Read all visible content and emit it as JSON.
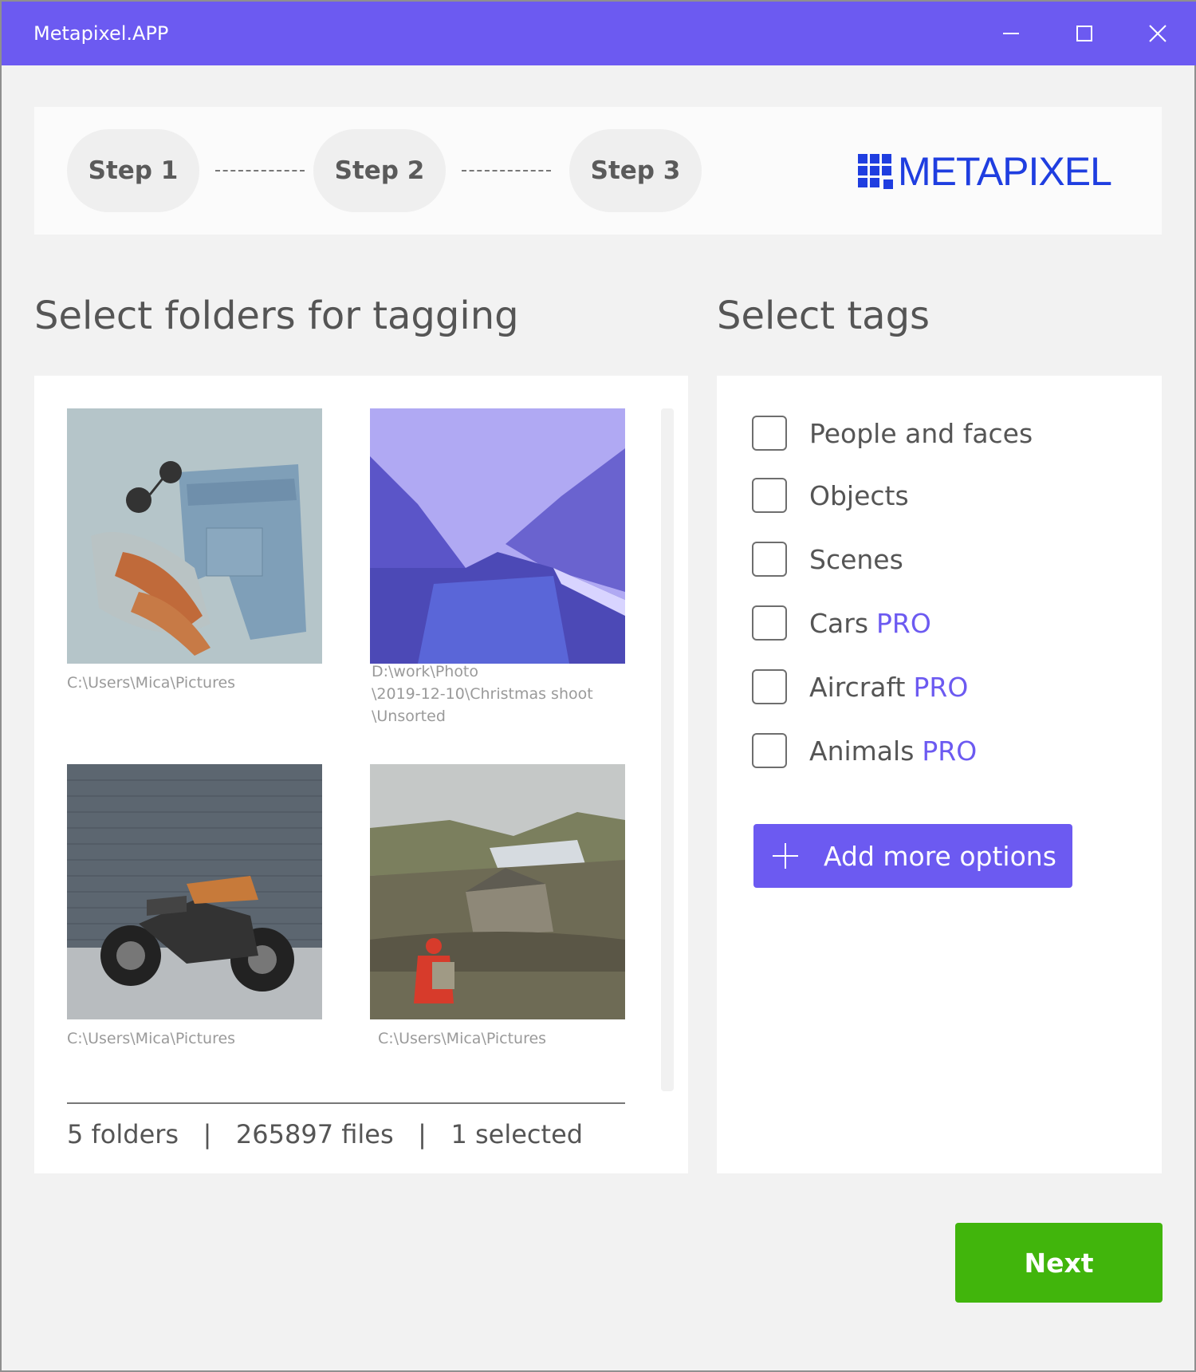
{
  "window": {
    "title": "Metapixel.APP",
    "accent_color": "#6c5af1",
    "controls": [
      "minimize-icon",
      "maximize-icon",
      "close-icon"
    ]
  },
  "steps": [
    {
      "label": "Step 1"
    },
    {
      "label": "Step 2"
    },
    {
      "label": "Step 3"
    }
  ],
  "logo": {
    "text": "METAPIXEL",
    "color": "#1f3ee0"
  },
  "folders": {
    "title": "Select folders for tagging",
    "items": [
      {
        "path": "C:\\Users\\Mica\\Pictures",
        "image": "denim-shorts-sunglasses-heels"
      },
      {
        "path": "D:\\work\\Photo\n\\2019-12-10\\Christmas shoot\n\\Unsorted",
        "image": "snowy-river-forest-purple"
      },
      {
        "path": "C:\\Users\\Mica\\Pictures",
        "image": "motorcycle-by-tiled-wall"
      },
      {
        "path": "C:\\Users\\Mica\\Pictures",
        "image": "hiker-red-jacket-stone-house-lake"
      }
    ],
    "stats": {
      "folders": "5 folders",
      "files": "265897 files",
      "selected": "1 selected",
      "separator": "|"
    }
  },
  "tags": {
    "title": "Select tags",
    "items": [
      {
        "label": "People and faces",
        "pro": "",
        "checked": false
      },
      {
        "label": "Objects",
        "pro": "",
        "checked": false
      },
      {
        "label": "Scenes",
        "pro": "",
        "checked": false
      },
      {
        "label": "Cars",
        "pro": "PRO",
        "checked": false
      },
      {
        "label": "Aircraft",
        "pro": "PRO",
        "checked": false
      },
      {
        "label": "Animals",
        "pro": "PRO",
        "checked": false
      }
    ],
    "add_button": {
      "label": "Add more options",
      "icon": "plus-icon"
    }
  },
  "next_button": {
    "label": "Next",
    "color": "#41b50c"
  }
}
